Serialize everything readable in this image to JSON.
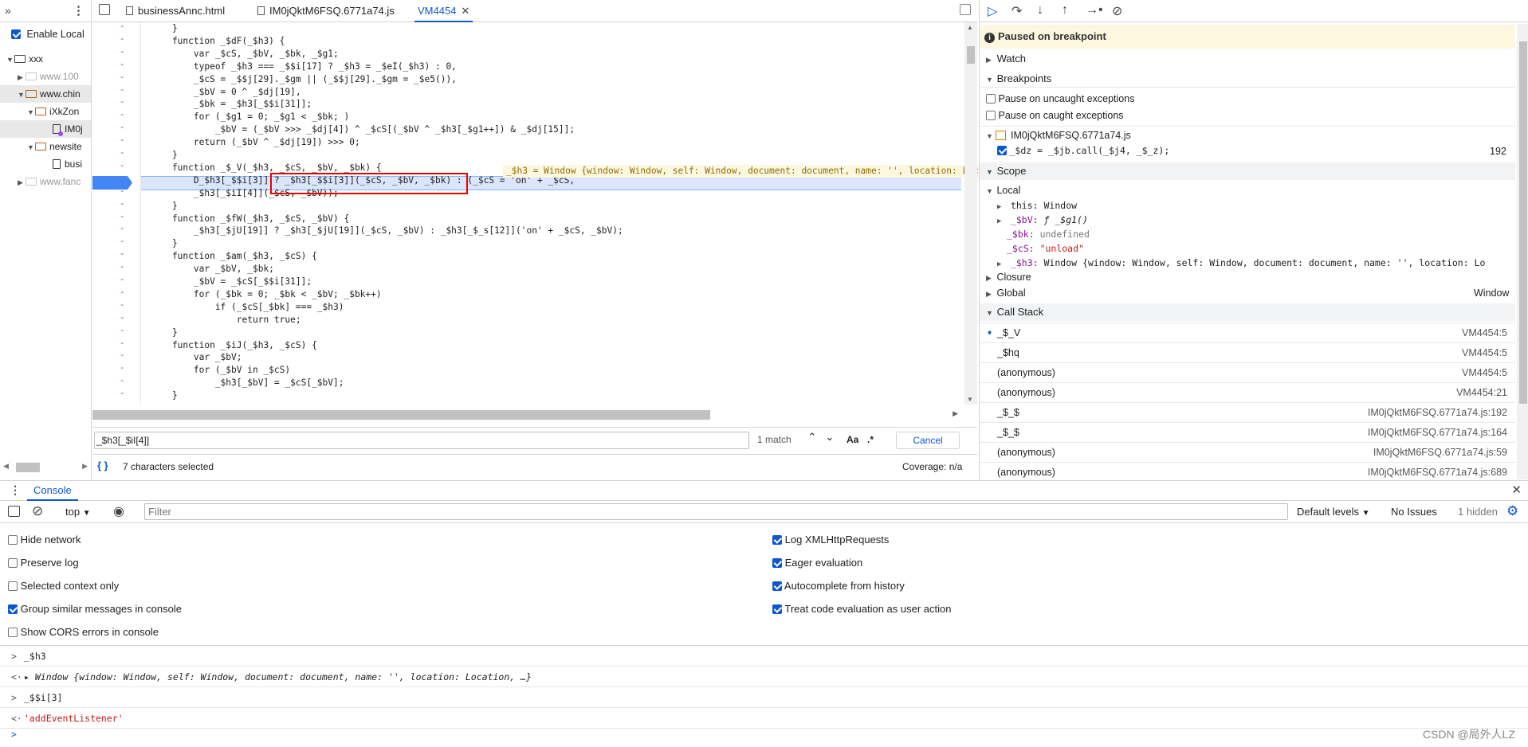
{
  "navigator": {
    "enable_local": "Enable Local",
    "tree": [
      "xxx",
      "www.100",
      "www.chin",
      "iXkZon",
      "IM0j",
      "newsite",
      "busi",
      "www.fanc"
    ]
  },
  "editor": {
    "tabs": [
      "businessAnnc.html",
      "IM0jQktM6FSQ.6771a74.js",
      "VM4454"
    ],
    "inline_value": "_$h3 = Window {window: Window, self: Window, document: document, name: '', location: Location",
    "search_value": "_$h3[_$iI[4]]",
    "match_count": "1 match",
    "case_label": "Aa",
    "regex_label": ".*",
    "cancel": "Cancel",
    "status_left": "7 characters selected",
    "status_right": "Coverage: n/a",
    "format_icon": "{ }"
  },
  "code_lines": [
    "    }",
    "    function _$dF(_$h3) {",
    "        var _$cS, _$bV, _$bk, _$g1;",
    "        typeof _$h3 === _$$i[17] ? _$h3 = _$eI(_$h3) : 0,",
    "        _$cS = _$$j[29]._$gm || (_$$j[29]._$gm = _$e5()),",
    "        _$bV = 0 ^ _$dj[19],",
    "        _$bk = _$h3[_$$i[31]];",
    "        for (_$g1 = 0; _$g1 < _$bk; )",
    "            _$bV = (_$bV >>> _$dj[4]) ^ _$cS[(_$bV ^ _$h3[_$g1++]) & _$dj[15]];",
    "        return (_$bV ^ _$dj[19]) >>> 0;",
    "    }",
    "    function _$_V(_$h3, _$cS, _$bV, _$bk) {",
    "        D_$h3[_$$i[3]] ? _$h3[_$$i[3]](_$cS, _$bV, _$bk) : (_$cS = 'on' + _$cS,",
    "        _$h3[_$iI[4]](_$cS, _$bV));",
    "    }",
    "    function _$fW(_$h3, _$cS, _$bV) {",
    "        _$h3[_$jU[19]] ? _$h3[_$jU[19]](_$cS, _$bV) : _$h3[_$_s[12]]('on' + _$cS, _$bV);",
    "    }",
    "    function _$am(_$h3, _$cS) {",
    "        var _$bV, _$bk;",
    "        _$bV = _$cS[_$$i[31]];",
    "        for (_$bk = 0; _$bk < _$bV; _$bk++)",
    "            if (_$cS[_$bk] === _$h3)",
    "                return true;",
    "    }",
    "    function _$iJ(_$h3, _$cS) {",
    "        var _$bV;",
    "        for (_$bV in _$cS)",
    "            _$h3[_$bV] = _$cS[_$bV];",
    "    }"
  ],
  "debugger": {
    "paused": "Paused on breakpoint",
    "watch": "Watch",
    "breakpoints": "Breakpoints",
    "pause_uncaught": "Pause on uncaught exceptions",
    "pause_caught": "Pause on caught exceptions",
    "bp_file": "IM0jQktM6FSQ.6771a74.js",
    "bp_code": "_$dz = _$jb.call(_$j4, _$_z);",
    "bp_line": "192",
    "scope": "Scope",
    "local": "Local",
    "this_label": "this:",
    "this_val": "Window",
    "bV_label": "_$bV:",
    "bV_val": "ƒ _$g1()",
    "bk_label": "_$bk:",
    "bk_val": "undefined",
    "cS_label": "_$cS:",
    "cS_val": "\"unload\"",
    "h3_label": "_$h3:",
    "h3_val": "Window {window: Window, self: Window, document: document, name: '', location: Lo",
    "closure": "Closure",
    "global": "Global",
    "global_val": "Window",
    "call_stack": "Call Stack",
    "frames": [
      {
        "fn": "_$_V",
        "loc": "VM4454:5"
      },
      {
        "fn": "_$hq",
        "loc": "VM4454:5"
      },
      {
        "fn": "(anonymous)",
        "loc": "VM4454:5"
      },
      {
        "fn": "(anonymous)",
        "loc": "VM4454:21"
      },
      {
        "fn": "_$_$",
        "loc": "IM0jQktM6FSQ.6771a74.js:192"
      },
      {
        "fn": "_$_$",
        "loc": "IM0jQktM6FSQ.6771a74.js:164"
      },
      {
        "fn": "(anonymous)",
        "loc": "IM0jQktM6FSQ.6771a74.js:59"
      },
      {
        "fn": "(anonymous)",
        "loc": "IM0jQktM6FSQ.6771a74.js:689"
      }
    ]
  },
  "console": {
    "tab": "Console",
    "context": "top",
    "filter_placeholder": "Filter",
    "levels": "Default levels",
    "issues": "No Issues",
    "hidden": "1 hidden",
    "options_left": [
      "Hide network",
      "Preserve log",
      "Selected context only",
      "Group similar messages in console",
      "Show CORS errors in console"
    ],
    "options_right": [
      "Log XMLHttpRequests",
      "Eager evaluation",
      "Autocomplete from history",
      "Treat code evaluation as user action"
    ],
    "lines": [
      {
        "arrow": ">",
        "text": "_$h3"
      },
      {
        "arrow": "<·",
        "text": "▸ Window {window: Window, self: Window, document: document, name: '', location: Location, …}"
      },
      {
        "arrow": ">",
        "text": "_$$i[3]"
      },
      {
        "arrow": "<·",
        "text": "'addEventListener'"
      }
    ],
    "prompt": ">"
  },
  "watermark": "CSDN @局外人LZ"
}
